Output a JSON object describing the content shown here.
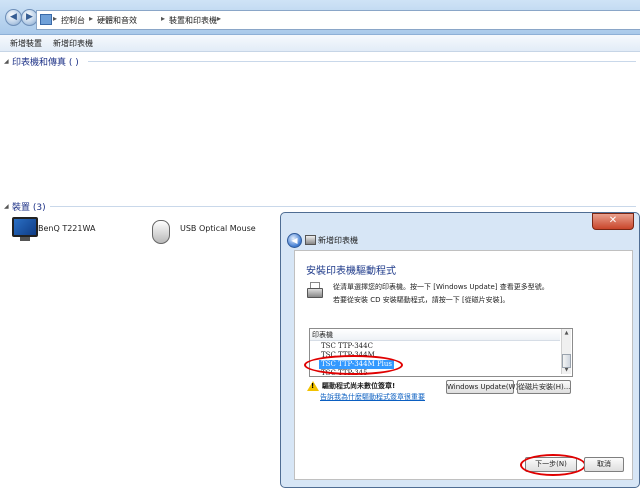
{
  "breadcrumb": {
    "items": [
      "控制台",
      "硬體和音效",
      "裝置和印表機"
    ]
  },
  "command_bar": {
    "add_device": "新增裝置",
    "add_printer": "新增印表機"
  },
  "groups": {
    "printers_header": "印表機和傳真 ( )",
    "devices_header": "裝置 (3)"
  },
  "devices": [
    {
      "label": "BenQ T221WA",
      "icon": "monitor-icon"
    },
    {
      "label": "USB Optical Mouse",
      "icon": "mouse-icon"
    }
  ],
  "dialog": {
    "window_title": "新增印表機",
    "heading": "安裝印表機驅動程式",
    "instruction_1": "從清單選擇您的印表機。按一下 [Windows Update] 查看更多型號。",
    "instruction_2": "若要從安裝 CD 安裝驅動程式，請按一下 [從磁片安裝]。",
    "list_header": "印表機",
    "printers": [
      "TSC TTP-344C",
      "TSC TTP-344M",
      "TSC TTP-344M Plus",
      "TSC TTP-345"
    ],
    "selected_printer": "TSC TTP-344M Plus",
    "warning_text": "驅動程式尚未數位簽章!",
    "warning_link": "告訴我為什麼驅動程式簽章很重要",
    "windows_update_button": "Windows Update(W)",
    "have_disk_button": "從磁片安裝(H)...",
    "next_button": "下一步(N)",
    "cancel_button": "取消",
    "close_glyph": "✕"
  },
  "colors": {
    "accent_link": "#0b5fc1",
    "selection": "#3399ff",
    "highlight_ring": "#e00000",
    "warning": "#f2c200"
  }
}
